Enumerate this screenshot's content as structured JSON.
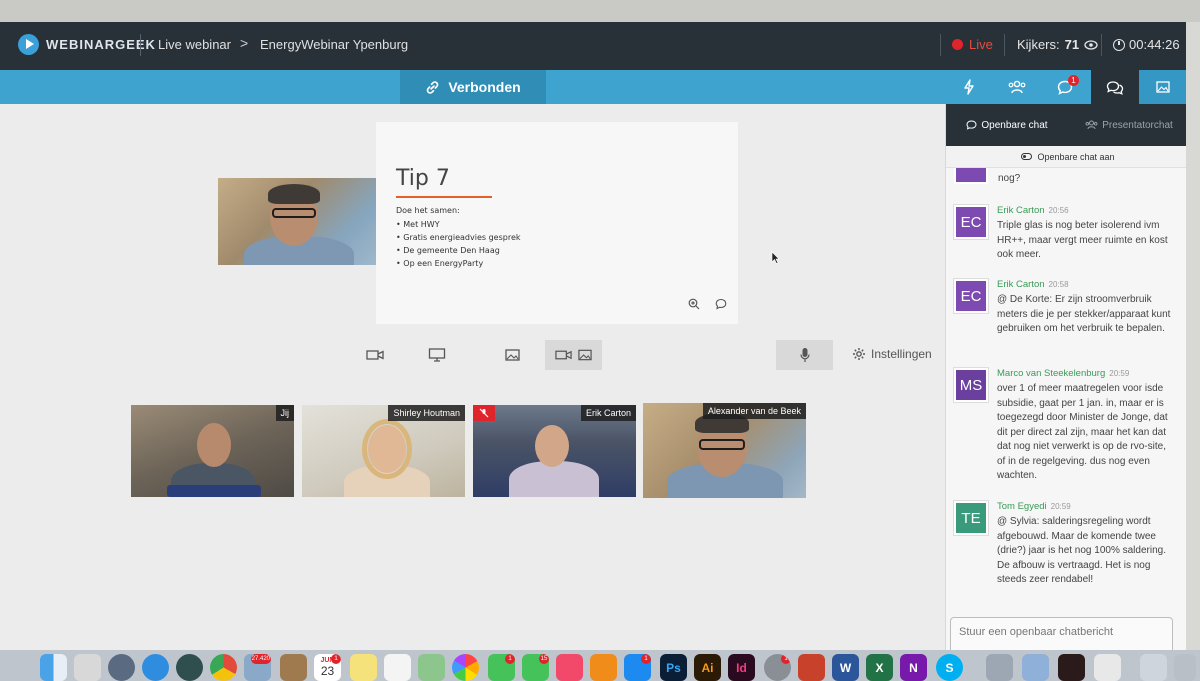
{
  "header": {
    "logo_text": "WEBINARGEEK",
    "crumb_live": "Live webinar",
    "crumb_arrow": ">",
    "webinar_title": "EnergyWebinar Ypenburg",
    "live_label": "Live",
    "viewers_label": "Kijkers:",
    "viewers_count": "71",
    "timer": "00:44:26"
  },
  "connection": {
    "status": "Verbonden",
    "notification_badge": "1"
  },
  "slide": {
    "title": "Tip 7",
    "intro": "Doe het samen:",
    "bullets": [
      "Met HWY",
      "Gratis energieadvies gesprek",
      "De gemeente Den Haag",
      "Op een EnergyParty"
    ]
  },
  "controls": {
    "settings_label": "Instellingen"
  },
  "participants": [
    {
      "name": "Jij"
    },
    {
      "name": "Shirley Houtman"
    },
    {
      "name": "Erik Carton"
    },
    {
      "name": "Alexander van de Beek"
    }
  ],
  "chat": {
    "tab_public": "Openbare chat",
    "tab_presenter": "Presentatorchat",
    "toggle_label": "Openbare chat aan",
    "fragment": "nog?",
    "messages": [
      {
        "initials": "EC",
        "author": "Erik Carton",
        "time": "20:56",
        "text": "Triple glas is nog beter isolerend ivm HR++, maar vergt meer ruimte en kost ook meer.",
        "color": "#7c4ab0"
      },
      {
        "initials": "EC",
        "author": "Erik Carton",
        "time": "20:58",
        "text": "@ De Korte: Er zijn stroomverbruik meters die je per stekker/apparaat kunt gebruiken om het verbruik te bepalen.",
        "color": "#7c4ab0"
      },
      {
        "initials": "MS",
        "author": "Marco van Steekelenburg",
        "time": "20:59",
        "text": "over 1 of meer maatregelen voor isde subsidie, gaat per 1 jan. in, maar er is toegezegd door Minister de Jonge, dat dit per direct zal zijn, maar het kan dat dat nog niet verwerkt is op de rvo-site, of in de regelgeving. dus nog even wachten.",
        "color": "#6a3f9e"
      },
      {
        "initials": "TE",
        "author": "Tom Egyedi",
        "time": "20:59",
        "text": "@ Sylvia: salderingsregeling wordt afgebouwd. Maar de komende twee (drie?) jaar is het nog 100% saldering. De afbouw is vertraagd. Het is nog steeds zeer rendabel!",
        "color": "#3a9a7c"
      }
    ],
    "input_placeholder": "Stuur een openbaar chatbericht"
  },
  "dock": {
    "calendar_month": "JUN",
    "calendar_day": "23",
    "badge_photos": "27.420",
    "badge_calendar": "1",
    "badge_messages": "1",
    "badge_facetime": "15",
    "badge_appstore": "1",
    "badge_settings": "1",
    "label_ps": "Ps",
    "label_ai": "Ai",
    "label_id": "Id",
    "label_word": "W",
    "label_excel": "X",
    "label_onenote": "N",
    "label_skype": "S"
  },
  "colors": {
    "topbar": "#283138",
    "accent": "#3fa3cf",
    "live_red": "#e0242b",
    "author_green": "#3a9a58"
  }
}
